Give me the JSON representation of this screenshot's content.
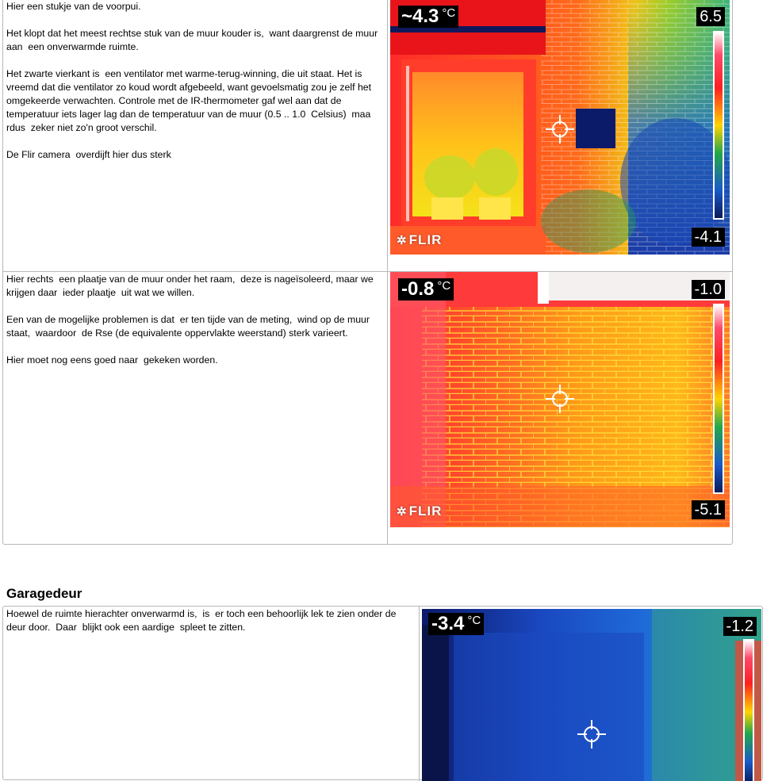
{
  "sections": [
    {
      "paragraphs": [
        "Hier een stukje van de voorpui.",
        "Het klopt dat het meest rechtse stuk van de muur kouder is,  want daargrenst de muur aan  een onverwarmde ruimte.",
        "Het zwarte vierkant is  een ventilator met warme-terug-winning, die uit staat. Het is vreemd dat die ventilator zo koud wordt afgebeeld, want gevoelsmatig zou je zelf het omgekeerde verwachten. Controle met de IR-thermometer gaf wel aan dat de temperatuur iets lager lag dan de temperatuur van de muur (0.5 .. 1.0  Celsius)  maa rdus  zeker niet zo'n groot verschil.",
        "De Flir camera  overdijft hier dus sterk"
      ],
      "thermal": {
        "spot": "~4.3",
        "unit": "°C",
        "max": "6.5",
        "min": "-4.1",
        "brand": "FLIR"
      }
    },
    {
      "paragraphs": [
        "Hier rechts  een plaatje van de muur onder het raam,  deze is nageïsoleerd, maar we krijgen daar  ieder plaatje  uit wat we willen.",
        "Een van de mogelijke problemen is dat  er ten tijde van de meting,  wind op de muur staat,  waardoor  de Rse (de equivalente oppervlakte weerstand) sterk varieert.",
        "Hier moet nog eens goed naar  gekeken worden."
      ],
      "thermal": {
        "spot": "-0.8",
        "unit": "°C",
        "max": "-1.0",
        "min": "-5.1",
        "brand": "FLIR"
      }
    }
  ],
  "garage": {
    "heading": "Garagedeur",
    "paragraphs": [
      "Hoewel de ruimte hierachter onverwarmd is,  is  er toch een behoorlijk lek te zien onder de deur door.  Daar  blijkt ook een aardige  spleet te zitten."
    ],
    "thermal": {
      "spot": "-3.4",
      "unit": "°C",
      "max": "-1.2"
    }
  },
  "colors": {
    "border": "#b7b7b7",
    "thermal_hot": "#ffffff",
    "thermal_warm": "#ff2020",
    "thermal_mid": "#ffd400",
    "thermal_cool": "#22a84a",
    "thermal_cold": "#1a2a9a"
  }
}
